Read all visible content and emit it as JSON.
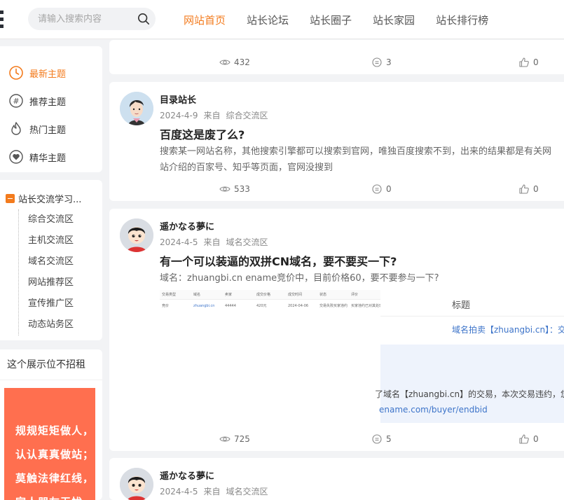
{
  "header": {
    "search_placeholder": "请输入搜索内容",
    "nav": [
      "网站首页",
      "站长论坛",
      "站长圈子",
      "站长家园",
      "站长排行榜"
    ]
  },
  "sidebar": {
    "menu": [
      {
        "label": "最新主题",
        "icon": "clock-icon"
      },
      {
        "label": "推荐主题",
        "icon": "hashtag-icon"
      },
      {
        "label": "热门主题",
        "icon": "flame-icon"
      },
      {
        "label": "精华主题",
        "icon": "heart-icon"
      }
    ],
    "forum_title": "站长交流学习...",
    "forum_items": [
      "综合交流区",
      "主机交流区",
      "域名交流区",
      "网站推荐区",
      "宣传推广区",
      "动态站务区"
    ],
    "ad_title": "这个展示位不招租",
    "ad_lines": [
      "规规矩矩做人，",
      "认认真真做站；",
      "莫触法律红线，",
      "家人朋友无忧"
    ]
  },
  "posts": [
    {
      "views": "432",
      "comments": "3",
      "likes": "0"
    },
    {
      "author": "目录站长",
      "date": "2024-4-9",
      "from_label": "来自",
      "forum": "综合交流区",
      "title": "百度这是废了么?",
      "excerpt_lines": [
        "搜索某一网站名称，其他搜索引擎都可以搜索到官网，唯独百度搜索不到，出来的结果都是有关网",
        "站介绍的百家号、知乎等页面，官网没搜到"
      ],
      "views": "533",
      "comments": "0",
      "likes": "0"
    },
    {
      "author": "遥かなる夢に",
      "date": "2024-4-5",
      "from_label": "来自",
      "forum": "域名交流区",
      "title": "有一个可以装逼的双拼CN域名，要不要买一下?",
      "excerpt_lines": [
        "域名：zhuangbi.cn ename竞价中，目前价格60，要不要参与一下?"
      ],
      "screenshot": {
        "headers": [
          "交易类型",
          "域名",
          "卖家",
          "成交价格",
          "成交时间",
          "状态",
          "评价"
        ],
        "row": [
          "竞价",
          "zhuangbi.cn",
          "44444",
          "420元",
          "2024-04-06",
          "交易失败买家违约",
          "买家违约已对其处理"
        ],
        "column_title": "标题",
        "link": "域名拍卖【zhuangbi.cn】：交",
        "notice": "了域名【zhuangbi.cn】的交易，本次交易违约，您",
        "url": "ename.com/buyer/endbid"
      },
      "views": "725",
      "comments": "5",
      "likes": "0"
    },
    {
      "author": "遥かなる夢に",
      "date": "2024-4-5",
      "from_label": "来自",
      "forum": "域名交流区"
    }
  ]
}
